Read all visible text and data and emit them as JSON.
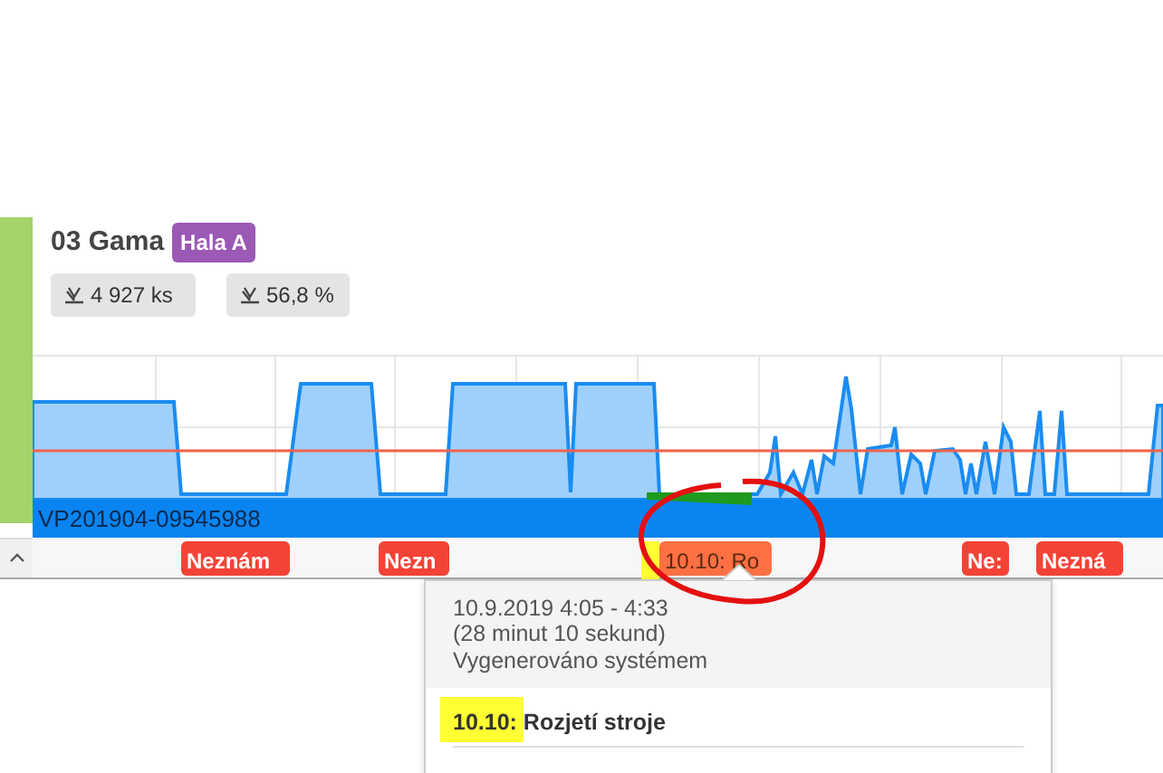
{
  "machine": {
    "title": "03 Gama",
    "hall": "Hala A",
    "stats": [
      {
        "text": "4 927 ks"
      },
      {
        "text": "56,8 %"
      }
    ]
  },
  "order_bar": {
    "text": "VP201904-09545988"
  },
  "events": [
    {
      "label": "Neznám",
      "color": "#f44336"
    },
    {
      "label": "Nezn",
      "color": "#f44336"
    },
    {
      "label": "10.10: Ro",
      "color": "#ff7043"
    },
    {
      "label": "Ne:",
      "color": "#f44336"
    },
    {
      "label": "Nezná",
      "color": "#f44336"
    }
  ],
  "popup": {
    "time": "10.9.2019 4:05 - 4:33",
    "duration": "(28 minut 10 sekund)",
    "source": "Vygenerováno systémem",
    "reason": "10.10: Rozjetí stroje"
  }
}
